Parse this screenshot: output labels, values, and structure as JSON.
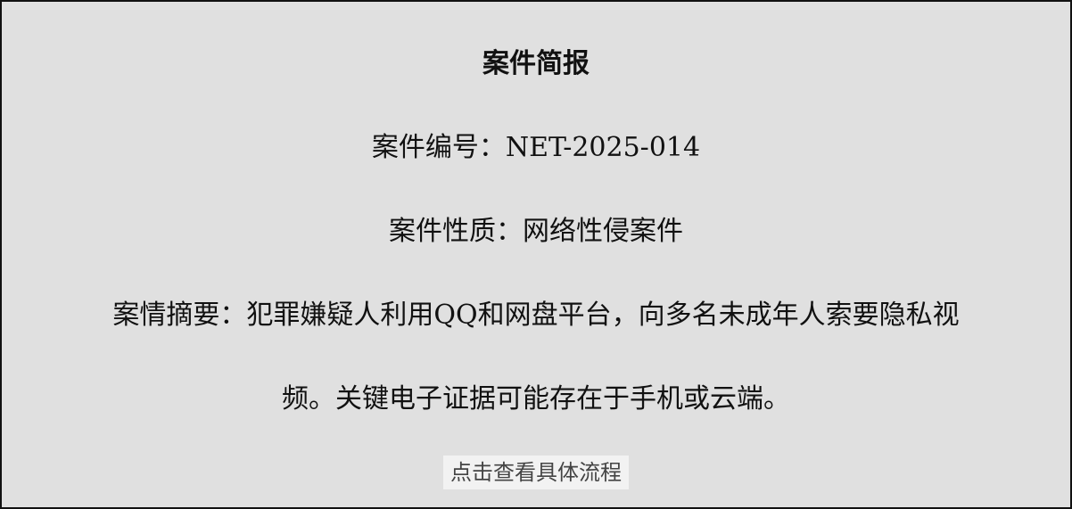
{
  "brief": {
    "title": "案件简报",
    "case_number_label": "案件编号：",
    "case_number_value": "NET-2025-014",
    "case_nature_label": "案件性质：",
    "case_nature_value": "网络性侵案件",
    "summary_label": "案情摘要：",
    "summary_line1": "犯罪嫌疑人利用QQ和网盘平台，向多名未成年人索要隐私视",
    "summary_line2": "频。关键电子证据可能存在于手机或云端。"
  },
  "action": {
    "button_label": "点击查看具体流程"
  }
}
